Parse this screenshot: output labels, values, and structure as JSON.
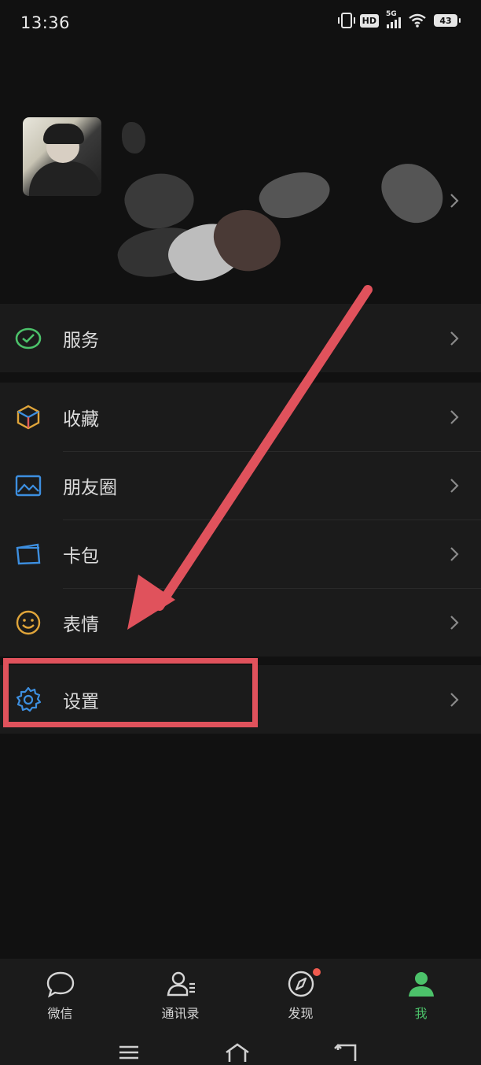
{
  "status_bar": {
    "time": "13:36",
    "hd_label": "HD",
    "network_label": "5G",
    "battery": "43"
  },
  "profile": {
    "avatar": "profile photo"
  },
  "menu": {
    "group1": [
      {
        "label": "服务",
        "icon": "service-check-icon",
        "color": "#4cc26a"
      }
    ],
    "group2": [
      {
        "label": "收藏",
        "icon": "favorites-cube-icon",
        "color": "#e0a53a"
      },
      {
        "label": "朋友圈",
        "icon": "moments-picture-icon",
        "color": "#3d8fe0"
      },
      {
        "label": "卡包",
        "icon": "card-wallet-icon",
        "color": "#3d8fe0"
      },
      {
        "label": "表情",
        "icon": "emoji-smile-icon",
        "color": "#e0a53a"
      }
    ],
    "group3": [
      {
        "label": "设置",
        "icon": "settings-gear-icon",
        "color": "#3d8fe0"
      }
    ]
  },
  "annotation": {
    "color": "#e0525c",
    "target": "设置"
  },
  "tabbar": {
    "tabs": [
      {
        "label": "微信",
        "icon": "chat-bubble-icon",
        "active": false
      },
      {
        "label": "通讯录",
        "icon": "contacts-icon",
        "active": false
      },
      {
        "label": "发现",
        "icon": "discover-compass-icon",
        "active": false,
        "badge": true
      },
      {
        "label": "我",
        "icon": "me-person-icon",
        "active": true
      }
    ],
    "active_color": "#4cc26a"
  },
  "system_nav": {
    "items": [
      "menu-icon",
      "home-icon",
      "back-icon"
    ]
  }
}
